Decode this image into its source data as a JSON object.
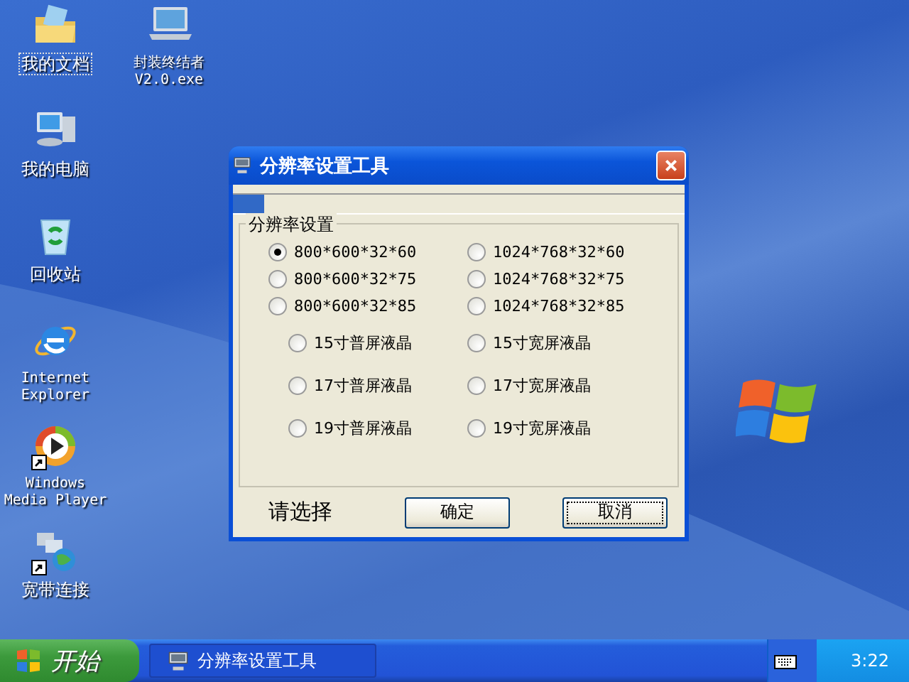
{
  "desktop_icons": [
    {
      "label": "我的文档",
      "kind": "documents",
      "shortcut": false,
      "focused": true
    },
    {
      "label": "我的电脑",
      "kind": "computer",
      "shortcut": false,
      "focused": false
    },
    {
      "label": "回收站",
      "kind": "recycle",
      "shortcut": false,
      "focused": false
    },
    {
      "label": "Internet Explorer",
      "kind": "browser",
      "shortcut": false,
      "focused": false
    },
    {
      "label": "Windows Media Player",
      "kind": "media",
      "shortcut": true,
      "focused": false
    },
    {
      "label": "宽带连接",
      "kind": "network",
      "shortcut": true,
      "focused": false
    },
    {
      "label": "封装终结者 V2.0.exe",
      "kind": "laptop",
      "shortcut": false,
      "focused": false
    }
  ],
  "window": {
    "title": "分辨率设置工具",
    "progress": {
      "level": 0.07
    },
    "group": {
      "title": "分辨率设置",
      "resolution_options": [
        {
          "label": "800*600*32*60",
          "selected": true
        },
        {
          "label": "1024*768*32*60",
          "selected": false
        },
        {
          "label": "800*600*32*75",
          "selected": false
        },
        {
          "label": "1024*768*32*75",
          "selected": false
        },
        {
          "label": "800*600*32*85",
          "selected": false
        },
        {
          "label": "1024*768*32*85",
          "selected": false
        }
      ],
      "panel_options": [
        {
          "label": "15寸普屏液晶",
          "selected": false
        },
        {
          "label": "15寸宽屏液晶",
          "selected": false
        },
        {
          "label": "17寸普屏液晶",
          "selected": false
        },
        {
          "label": "17寸宽屏液晶",
          "selected": false
        },
        {
          "label": "19寸普屏液晶",
          "selected": false
        },
        {
          "label": "19寸宽屏液晶",
          "selected": false
        }
      ]
    },
    "prompt": "请选择",
    "buttons": [
      {
        "label": "确定",
        "focused": false
      },
      {
        "label": "取消",
        "focused": true
      }
    ]
  },
  "taskbar": {
    "start": "开始",
    "tasks": [
      {
        "label": "分辨率设置工具",
        "selected": false
      }
    ],
    "clock": "3:22"
  }
}
